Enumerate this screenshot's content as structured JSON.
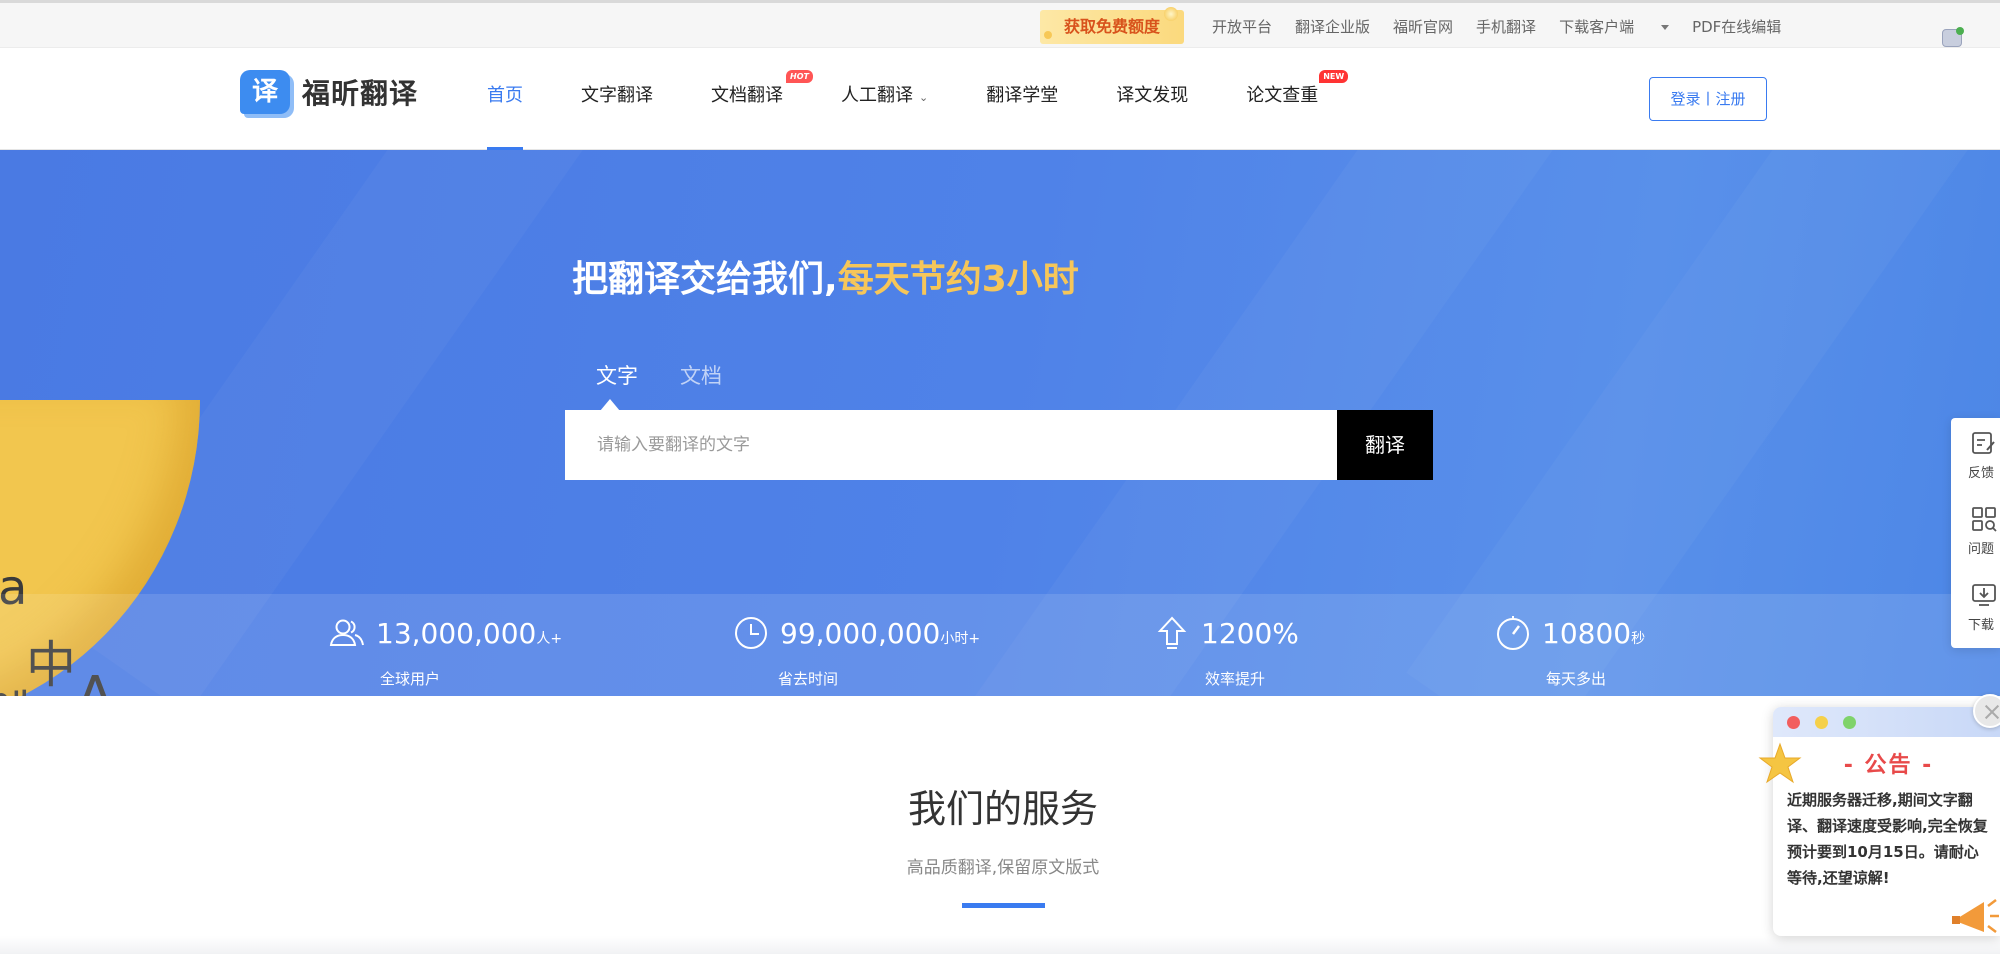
{
  "topbar": {
    "promo_label": "获取免费额度",
    "links": [
      "开放平台",
      "翻译企业版",
      "福昕官网",
      "手机翻译",
      "下载客户端",
      "PDF在线编辑"
    ]
  },
  "nav": {
    "logo_mark": "译",
    "logo_text": "福昕翻译",
    "items": [
      {
        "label": "首页"
      },
      {
        "label": "文字翻译"
      },
      {
        "label": "文档翻译",
        "tag": "HOT"
      },
      {
        "label": "人工翻译"
      },
      {
        "label": "翻译学堂"
      },
      {
        "label": "译文发现"
      },
      {
        "label": "论文查重",
        "tag": "NEW"
      }
    ],
    "login_label": "登录丨注册"
  },
  "hero": {
    "headline_main": "把翻译交给我们,",
    "headline_highlight": "每天节约3小时",
    "tabs": [
      "文字",
      "文档"
    ],
    "search_placeholder": "请输入要翻译的文字",
    "translate_button": "翻译",
    "peel_letters": [
      "a",
      "中",
      "A",
      "에"
    ]
  },
  "stats": [
    {
      "icon": "users-icon",
      "value": "13,000,000",
      "unit": "人+",
      "label": "全球用户"
    },
    {
      "icon": "clock-icon",
      "value": "99,000,000",
      "unit": "小时+",
      "label": "省去时间"
    },
    {
      "icon": "arrow-up-icon",
      "value": "1200%",
      "unit": "",
      "label": "效率提升"
    },
    {
      "icon": "speedometer-icon",
      "value": "10800",
      "unit": "秒",
      "label": "每天多出"
    }
  ],
  "sidebar": [
    {
      "icon": "feedback-icon",
      "label": "反馈"
    },
    {
      "icon": "grid-search-icon",
      "label": "问题"
    },
    {
      "icon": "download-icon",
      "label": "下载"
    }
  ],
  "services": {
    "title": "我们的服务",
    "subtitle": "高品质翻译,保留原文版式"
  },
  "notice": {
    "title": "- 公告 -",
    "text": "近期服务器迁移,期间文字翻译、翻译速度受影响,完全恢复预计要到10月15日。请耐心等待,还望谅解!"
  },
  "colors": {
    "accent": "#3a7bf0",
    "hero_bg": "#4f82e8",
    "highlight": "#f6c659",
    "promo_text": "#d8531c",
    "notice_title": "#e84a4a"
  }
}
